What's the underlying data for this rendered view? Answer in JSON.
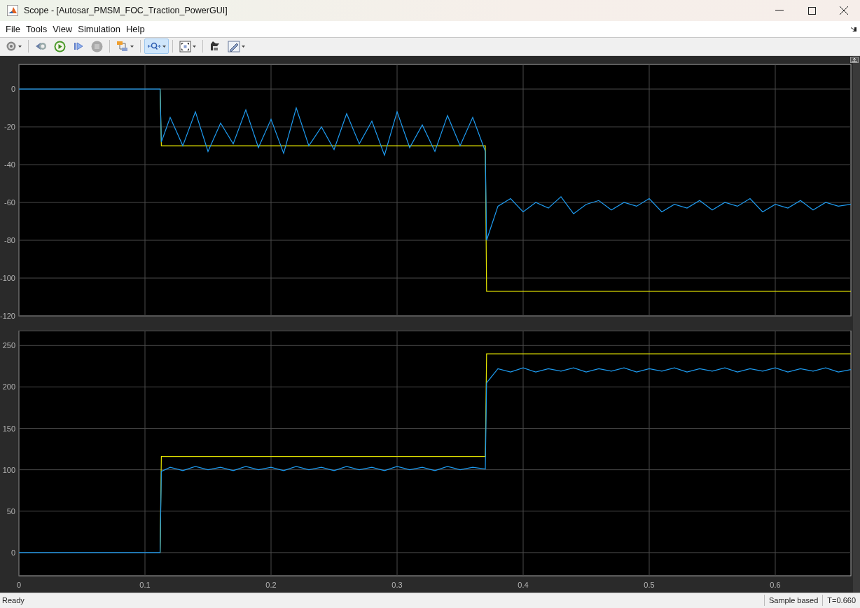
{
  "window": {
    "title": "Scope - [Autosar_PMSM_FOC_Traction_PowerGUI]"
  },
  "menu": [
    "File",
    "Tools",
    "View",
    "Simulation",
    "Help"
  ],
  "toolbar": [
    {
      "kind": "settings",
      "dropdown": true,
      "selected": false
    },
    {
      "kind": "step-back",
      "dropdown": false,
      "selected": false
    },
    {
      "kind": "run",
      "dropdown": false,
      "selected": false
    },
    {
      "kind": "step-forward",
      "dropdown": false,
      "selected": false
    },
    {
      "kind": "stop",
      "dropdown": false,
      "selected": false
    },
    {
      "kind": "signals",
      "dropdown": true,
      "selected": false
    },
    {
      "kind": "zoom",
      "dropdown": true,
      "selected": true
    },
    {
      "kind": "fit",
      "dropdown": true,
      "selected": false
    },
    {
      "kind": "style",
      "dropdown": false,
      "selected": false
    },
    {
      "kind": "measure",
      "dropdown": true,
      "selected": false
    }
  ],
  "plots": [
    {
      "chart_data": {
        "type": "line",
        "grid": true,
        "xlim": [
          0,
          0.66
        ],
        "ylim": [
          -120,
          13
        ],
        "yticks": [
          0,
          -20,
          -40,
          -60,
          -80,
          -100,
          -120
        ],
        "x": [
          0,
          0.01,
          0.02,
          0.03,
          0.04,
          0.05,
          0.06,
          0.07,
          0.08,
          0.09,
          0.1,
          0.11,
          0.112,
          0.113,
          0.12,
          0.13,
          0.14,
          0.15,
          0.16,
          0.17,
          0.18,
          0.19,
          0.2,
          0.21,
          0.22,
          0.23,
          0.24,
          0.25,
          0.26,
          0.27,
          0.28,
          0.29,
          0.3,
          0.31,
          0.32,
          0.33,
          0.34,
          0.35,
          0.36,
          0.37,
          0.371,
          0.38,
          0.39,
          0.4,
          0.41,
          0.42,
          0.43,
          0.44,
          0.45,
          0.46,
          0.47,
          0.48,
          0.49,
          0.5,
          0.51,
          0.52,
          0.53,
          0.54,
          0.55,
          0.56,
          0.57,
          0.58,
          0.59,
          0.6,
          0.61,
          0.62,
          0.63,
          0.64,
          0.65,
          0.66
        ],
        "series": [
          {
            "color": "#e6e600",
            "values": [
              null,
              null,
              null,
              null,
              null,
              null,
              null,
              null,
              null,
              null,
              null,
              null,
              0,
              -30,
              -30,
              -30,
              -30,
              -30,
              -30,
              -30,
              -30,
              -30,
              -30,
              -30,
              -30,
              -30,
              -30,
              -30,
              -30,
              -30,
              -30,
              -30,
              -30,
              -30,
              -30,
              -30,
              -30,
              -30,
              -30,
              -30,
              -107,
              -107,
              -107,
              -107,
              -107,
              -107,
              -107,
              -107,
              -107,
              -107,
              -107,
              -107,
              -107,
              -107,
              -107,
              -107,
              -107,
              -107,
              -107,
              -107,
              -107,
              -107,
              -107,
              -107,
              -107,
              -107,
              -107,
              -107,
              -107,
              -107
            ]
          },
          {
            "color": "#1e9bf0",
            "values": [
              0,
              0,
              0,
              0,
              0,
              0,
              0,
              0,
              0,
              0,
              0,
              0,
              0,
              -28,
              -15,
              -30,
              -12,
              -33,
              -18,
              -29,
              -11,
              -31,
              -16,
              -34,
              -10,
              -30,
              -20,
              -32,
              -13,
              -29,
              -17,
              -35,
              -12,
              -31,
              -19,
              -33,
              -14,
              -30,
              -15,
              -33,
              -80,
              -62,
              -58,
              -65,
              -60,
              -63,
              -57,
              -66,
              -61,
              -59,
              -64,
              -60,
              -62,
              -58,
              -65,
              -61,
              -63,
              -59,
              -64,
              -60,
              -62,
              -58,
              -65,
              -61,
              -63,
              -59,
              -64,
              -60,
              -62,
              -61
            ]
          }
        ]
      }
    },
    {
      "chart_data": {
        "type": "line",
        "grid": true,
        "xlim": [
          0,
          0.66
        ],
        "ylim": [
          -28,
          268
        ],
        "xticks": [
          0,
          0.1,
          0.2,
          0.3,
          0.4,
          0.5,
          0.6
        ],
        "yticks": [
          0,
          50,
          100,
          150,
          200,
          250
        ],
        "x": [
          0,
          0.01,
          0.02,
          0.03,
          0.04,
          0.05,
          0.06,
          0.07,
          0.08,
          0.09,
          0.1,
          0.11,
          0.112,
          0.113,
          0.12,
          0.13,
          0.14,
          0.15,
          0.16,
          0.17,
          0.18,
          0.19,
          0.2,
          0.21,
          0.22,
          0.23,
          0.24,
          0.25,
          0.26,
          0.27,
          0.28,
          0.29,
          0.3,
          0.31,
          0.32,
          0.33,
          0.34,
          0.35,
          0.36,
          0.37,
          0.371,
          0.38,
          0.39,
          0.4,
          0.41,
          0.42,
          0.43,
          0.44,
          0.45,
          0.46,
          0.47,
          0.48,
          0.49,
          0.5,
          0.51,
          0.52,
          0.53,
          0.54,
          0.55,
          0.56,
          0.57,
          0.58,
          0.59,
          0.6,
          0.61,
          0.62,
          0.63,
          0.64,
          0.65,
          0.66
        ],
        "series": [
          {
            "color": "#e6e600",
            "values": [
              null,
              null,
              null,
              null,
              null,
              null,
              null,
              null,
              null,
              null,
              null,
              null,
              0,
              116,
              116,
              116,
              116,
              116,
              116,
              116,
              116,
              116,
              116,
              116,
              116,
              116,
              116,
              116,
              116,
              116,
              116,
              116,
              116,
              116,
              116,
              116,
              116,
              116,
              116,
              116,
              240,
              240,
              240,
              240,
              240,
              240,
              240,
              240,
              240,
              240,
              240,
              240,
              240,
              240,
              240,
              240,
              240,
              240,
              240,
              240,
              240,
              240,
              240,
              240,
              240,
              240,
              240,
              240,
              240,
              240
            ]
          },
          {
            "color": "#1e9bf0",
            "values": [
              0,
              0,
              0,
              0,
              0,
              0,
              0,
              0,
              0,
              0,
              0,
              0,
              0,
              98,
              103,
              99,
              104,
              100,
              103,
              99,
              104,
              100,
              103,
              99,
              104,
              100,
              103,
              99,
              104,
              100,
              103,
              99,
              104,
              100,
              103,
              99,
              104,
              100,
              103,
              101,
              205,
              222,
              218,
              223,
              218,
              222,
              219,
              223,
              218,
              222,
              219,
              223,
              218,
              222,
              219,
              223,
              218,
              222,
              219,
              223,
              218,
              222,
              219,
              223,
              218,
              222,
              219,
              223,
              218,
              221
            ]
          }
        ]
      }
    }
  ],
  "status_bar": {
    "message": "Ready",
    "mode": "Sample based",
    "time": "T=0.660"
  }
}
